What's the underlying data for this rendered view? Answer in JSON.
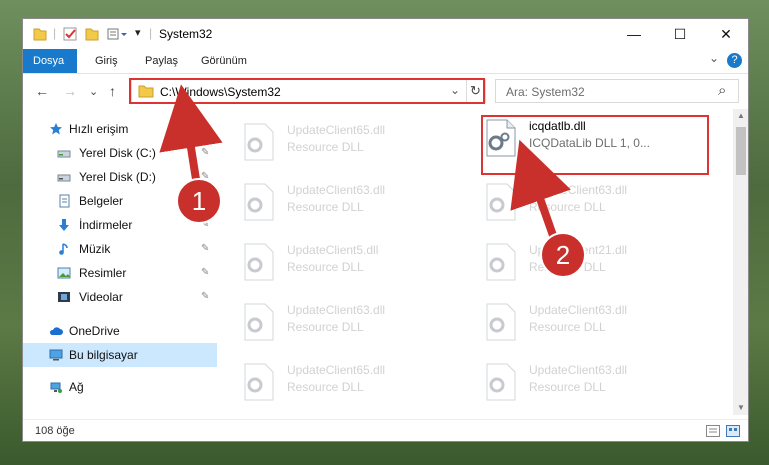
{
  "window": {
    "title": "System32",
    "minimize_glyph": "—",
    "maximize_glyph": "☐",
    "close_glyph": "✕"
  },
  "ribbon": {
    "tabs": [
      "Dosya",
      "Giriş",
      "Paylaş",
      "Görünüm"
    ],
    "expand_glyph": "⌄",
    "help_glyph": "?"
  },
  "address": {
    "path": "C:\\Windows\\System32",
    "dropdown_glyph": "⌄",
    "refresh_glyph": "↻"
  },
  "search": {
    "placeholder": "Ara: System32",
    "icon_glyph": "⌕"
  },
  "nav_buttons": {
    "back": "←",
    "forward": "→",
    "recent": "⌄",
    "up": "↑"
  },
  "sidebar": {
    "quick_access": "Hızlı erişim",
    "items": [
      {
        "label": "Yerel Disk (C:)",
        "icon": "drive-icon",
        "pinned": true
      },
      {
        "label": "Yerel Disk (D:)",
        "icon": "drive-icon",
        "pinned": true
      },
      {
        "label": "Belgeler",
        "icon": "documents-icon",
        "pinned": true
      },
      {
        "label": "İndirmeler",
        "icon": "download-icon",
        "pinned": true
      },
      {
        "label": "Müzik",
        "icon": "music-icon",
        "pinned": true
      },
      {
        "label": "Resimler",
        "icon": "pictures-icon",
        "pinned": true
      },
      {
        "label": "Videolar",
        "icon": "videos-icon",
        "pinned": true
      }
    ],
    "onedrive": "OneDrive",
    "this_pc": "Bu bilgisayar",
    "network": "Ağ"
  },
  "files": {
    "left_column": [
      {
        "name": "UpdateClient65.dll",
        "desc": "Resource DLL"
      },
      {
        "name": "UpdateClient63.dll",
        "desc": "Resource DLL"
      },
      {
        "name": "UpdateClient5.dll",
        "desc": "Resource DLL"
      },
      {
        "name": "UpdateClient63.dll",
        "desc": "Resource DLL"
      },
      {
        "name": "UpdateClient65.dll",
        "desc": "Resource DLL"
      }
    ],
    "right_column": [
      {
        "name": "icqdatlb.dll",
        "desc": "ICQDataLib DLL 1, 0..."
      },
      {
        "name": "UpdateClient63.dll",
        "desc": "Resource DLL"
      },
      {
        "name": "UpdateClient21.dll",
        "desc": "Resource DLL"
      },
      {
        "name": "UpdateClient63.dll",
        "desc": "Resource DLL"
      },
      {
        "name": "UpdateClient63.dll",
        "desc": "Resource DLL"
      }
    ]
  },
  "status": {
    "item_count": "108 öğe"
  },
  "callouts": {
    "one": "1",
    "two": "2"
  },
  "colors": {
    "accent": "#1979ca",
    "highlight": "#d33333",
    "callout": "#c9302c",
    "selected": "#cce8ff"
  }
}
